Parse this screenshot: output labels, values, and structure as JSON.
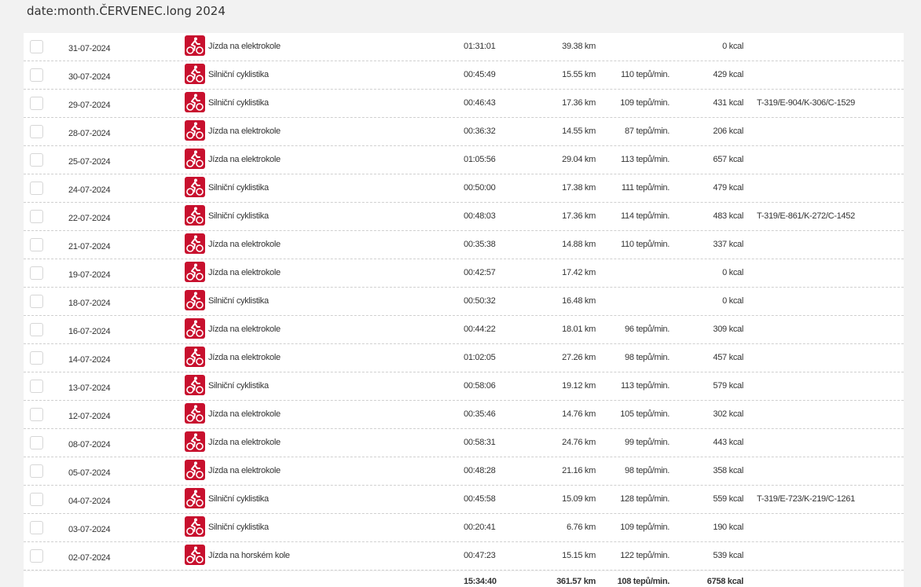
{
  "month_title": "date:month.ČERVENEC.long 2024",
  "activities": [
    {
      "date": "31-07-2024",
      "type": "Jízda na elektrokole",
      "duration": "01:31:01",
      "distance": "39.38 km",
      "heart_rate": "",
      "calories": "0 kcal",
      "code": ""
    },
    {
      "date": "30-07-2024",
      "type": "Silniční cyklistika",
      "duration": "00:45:49",
      "distance": "15.55 km",
      "heart_rate": "110 tepů/min.",
      "calories": "429 kcal",
      "code": ""
    },
    {
      "date": "29-07-2024",
      "type": "Silniční cyklistika",
      "duration": "00:46:43",
      "distance": "17.36 km",
      "heart_rate": "109 tepů/min.",
      "calories": "431 kcal",
      "code": "T-319/E-904/K-306/C-1529"
    },
    {
      "date": "28-07-2024",
      "type": "Jízda na elektrokole",
      "duration": "00:36:32",
      "distance": "14.55 km",
      "heart_rate": "87 tepů/min.",
      "calories": "206 kcal",
      "code": ""
    },
    {
      "date": "25-07-2024",
      "type": "Jízda na elektrokole",
      "duration": "01:05:56",
      "distance": "29.04 km",
      "heart_rate": "113 tepů/min.",
      "calories": "657 kcal",
      "code": ""
    },
    {
      "date": "24-07-2024",
      "type": "Silniční cyklistika",
      "duration": "00:50:00",
      "distance": "17.38 km",
      "heart_rate": "111 tepů/min.",
      "calories": "479 kcal",
      "code": ""
    },
    {
      "date": "22-07-2024",
      "type": "Silniční cyklistika",
      "duration": "00:48:03",
      "distance": "17.36 km",
      "heart_rate": "114 tepů/min.",
      "calories": "483 kcal",
      "code": "T-319/E-861/K-272/C-1452"
    },
    {
      "date": "21-07-2024",
      "type": "Jízda na elektrokole",
      "duration": "00:35:38",
      "distance": "14.88 km",
      "heart_rate": "110 tepů/min.",
      "calories": "337 kcal",
      "code": ""
    },
    {
      "date": "19-07-2024",
      "type": "Jízda na elektrokole",
      "duration": "00:42:57",
      "distance": "17.42 km",
      "heart_rate": "",
      "calories": "0 kcal",
      "code": ""
    },
    {
      "date": "18-07-2024",
      "type": "Silniční cyklistika",
      "duration": "00:50:32",
      "distance": "16.48 km",
      "heart_rate": "",
      "calories": "0 kcal",
      "code": ""
    },
    {
      "date": "16-07-2024",
      "type": "Jízda na elektrokole",
      "duration": "00:44:22",
      "distance": "18.01 km",
      "heart_rate": "96 tepů/min.",
      "calories": "309 kcal",
      "code": ""
    },
    {
      "date": "14-07-2024",
      "type": "Jízda na elektrokole",
      "duration": "01:02:05",
      "distance": "27.26 km",
      "heart_rate": "98 tepů/min.",
      "calories": "457 kcal",
      "code": ""
    },
    {
      "date": "13-07-2024",
      "type": "Silniční cyklistika",
      "duration": "00:58:06",
      "distance": "19.12 km",
      "heart_rate": "113 tepů/min.",
      "calories": "579 kcal",
      "code": ""
    },
    {
      "date": "12-07-2024",
      "type": "Jízda na elektrokole",
      "duration": "00:35:46",
      "distance": "14.76 km",
      "heart_rate": "105 tepů/min.",
      "calories": "302 kcal",
      "code": ""
    },
    {
      "date": "08-07-2024",
      "type": "Jízda na elektrokole",
      "duration": "00:58:31",
      "distance": "24.76 km",
      "heart_rate": "99 tepů/min.",
      "calories": "443 kcal",
      "code": ""
    },
    {
      "date": "05-07-2024",
      "type": "Jízda na elektrokole",
      "duration": "00:48:28",
      "distance": "21.16 km",
      "heart_rate": "98 tepů/min.",
      "calories": "358 kcal",
      "code": ""
    },
    {
      "date": "04-07-2024",
      "type": "Silniční cyklistika",
      "duration": "00:45:58",
      "distance": "15.09 km",
      "heart_rate": "128 tepů/min.",
      "calories": "559 kcal",
      "code": "T-319/E-723/K-219/C-1261"
    },
    {
      "date": "03-07-2024",
      "type": "Silniční cyklistika",
      "duration": "00:20:41",
      "distance": "6.76 km",
      "heart_rate": "109 tepů/min.",
      "calories": "190 kcal",
      "code": ""
    },
    {
      "date": "02-07-2024",
      "type": "Jízda na horském kole",
      "duration": "00:47:23",
      "distance": "15.15 km",
      "heart_rate": "122 tepů/min.",
      "calories": "539 kcal",
      "code": ""
    }
  ],
  "totals": {
    "duration": "15:34:40",
    "distance": "361.57 km",
    "heart_rate": "108 tepů/min.",
    "calories": "6758 kcal"
  },
  "colors": {
    "icon_bg": "#c8102e",
    "background": "#f2f2f2",
    "row_bg": "#ffffff"
  },
  "icon_name": "cycling-icon"
}
